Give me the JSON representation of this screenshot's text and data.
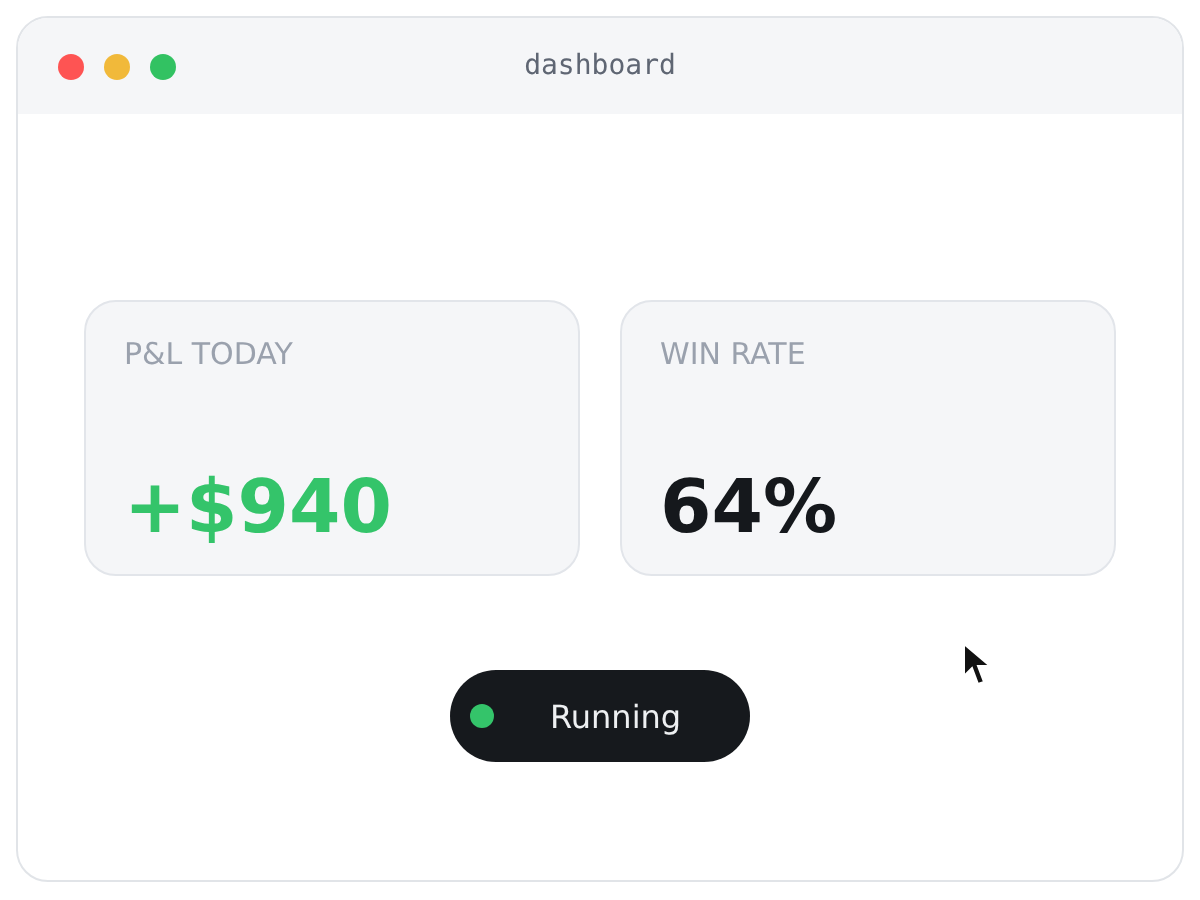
{
  "window": {
    "title": "dashboard"
  },
  "cards": [
    {
      "label": "P&L TODAY",
      "value": "+$940",
      "color": "#34c46a"
    },
    {
      "label": "WIN RATE",
      "value": "64%",
      "color": "#15181c"
    }
  ],
  "status": {
    "label": "Running",
    "color": "#34c46a"
  }
}
